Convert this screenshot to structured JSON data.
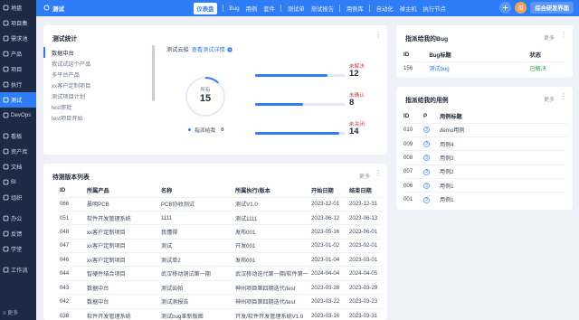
{
  "sidebar": {
    "items": [
      {
        "label": "地盘",
        "icon": "home-icon"
      },
      {
        "label": "项目集",
        "icon": "program-icon"
      },
      {
        "label": "需求池",
        "icon": "demand-icon"
      },
      {
        "label": "产品",
        "icon": "product-icon"
      },
      {
        "label": "项目",
        "icon": "project-icon"
      },
      {
        "label": "执行",
        "icon": "execution-icon"
      },
      {
        "label": "测试",
        "icon": "test-icon",
        "active": true
      },
      {
        "label": "DevOps",
        "icon": "devops-icon"
      },
      {
        "label": "看板",
        "icon": "kanban-icon"
      },
      {
        "label": "资产库",
        "icon": "asset-icon"
      },
      {
        "label": "文档",
        "icon": "doc-icon"
      },
      {
        "label": "BI",
        "icon": "bi-icon"
      },
      {
        "label": "组织",
        "icon": "org-icon"
      },
      {
        "label": "办公",
        "icon": "office-icon"
      },
      {
        "label": "反馈",
        "icon": "feedback-icon"
      },
      {
        "label": "学堂",
        "icon": "school-icon"
      },
      {
        "label": "工作流",
        "icon": "workflow-icon"
      }
    ],
    "more_label": "更多"
  },
  "topbar": {
    "title": "测试",
    "nav": [
      "仪表盘",
      "Bug",
      "用例",
      "套件",
      "测试单",
      "测试报告",
      "用例库",
      "自动化",
      "禅主机",
      "执行节点"
    ],
    "active_nav": "仪表盘",
    "avatar_text": "瓜",
    "cta_label": "综合研发界面"
  },
  "stats": {
    "title": "测试统计",
    "tabs": [
      "数据中台",
      "我试试这个产品",
      "多平台产品",
      "xx客户定制项目",
      "测试项目计划",
      "test审批",
      "test项目开始"
    ],
    "active_tab": 0,
    "cloud_label": "测试云船",
    "detail_link": "查看测试详情",
    "ring_label": "所有",
    "ring_value": "15",
    "assigned_label": "指派给我",
    "assigned_value": "0",
    "metrics": [
      {
        "label": "未解决",
        "value": "12",
        "fraction": 0.8
      },
      {
        "label": "未确认",
        "value": "8",
        "fraction": 0.53
      },
      {
        "label": "未关闭",
        "value": "14",
        "fraction": 0.93
      }
    ]
  },
  "bugs": {
    "title": "指派给我的Bug",
    "more_label": "更多",
    "headers": [
      "ID",
      "Bug标题",
      "状态"
    ],
    "rows": [
      [
        "156",
        "测试bug",
        "已解决"
      ]
    ]
  },
  "cases": {
    "title": "指派给我的用例",
    "more_label": "更多",
    "headers": [
      "ID",
      "P",
      "用例标题"
    ],
    "rows": [
      [
        "010",
        "3",
        "demo用例"
      ],
      [
        "009",
        "3",
        "用例4"
      ],
      [
        "008",
        "3",
        "用例3"
      ],
      [
        "007",
        "3",
        "用例2"
      ],
      [
        "006",
        "3",
        "用例1"
      ],
      [
        "001",
        "3",
        "用例1"
      ]
    ]
  },
  "builds": {
    "title": "待测版本列表",
    "more_label": "更多",
    "headers": [
      "ID",
      "所属产品",
      "名称",
      "所属执行/版本",
      "开始日期",
      "结束日期"
    ],
    "rows": [
      [
        "066",
        "晨明PCB",
        "PCB协收测试",
        "测试V1.0",
        "2023-12-01",
        "2023-12-31"
      ],
      [
        "051",
        "软件开发管理系统",
        "1111",
        "测试1111",
        "2023-06-12",
        "2023-06-13"
      ],
      [
        "048",
        "xx客户定制项目",
        "我懂得",
        "发布001",
        "2023-05-16",
        "2023-06-01"
      ],
      [
        "047",
        "xx客户定制项目",
        "测试",
        "开发001",
        "2023-01-02",
        "2023-02-01"
      ],
      [
        "046",
        "xx客户定制项目",
        "测试单2",
        "发布001",
        "2023-01-04",
        "2023-03-01"
      ],
      [
        "044",
        "智硬件结合项目",
        "武汉移动测试第一期",
        "武汉移动迭代第一期/软件第一",
        "2024-04-04",
        "2024-04-05"
      ],
      [
        "043",
        "数据中台",
        "测试云帕",
        "神州项目第四期迭代/test",
        "2023-03-28",
        "2023-03-29"
      ],
      [
        "042",
        "数据中台",
        "测试测报告",
        "神州项目第四期迭代/test",
        "2023-03-22",
        "2023-03-23"
      ],
      [
        "038",
        "软件开发管理系统",
        "测试bug革新版图",
        "开发/软件开发管理系统V1.0",
        "2023-03-16",
        "2023-03-31"
      ]
    ]
  },
  "colors": {
    "accent": "#2e7cf6",
    "sidebar": "#1e2a45",
    "success": "#2aa84a",
    "danger": "#c5473b"
  }
}
